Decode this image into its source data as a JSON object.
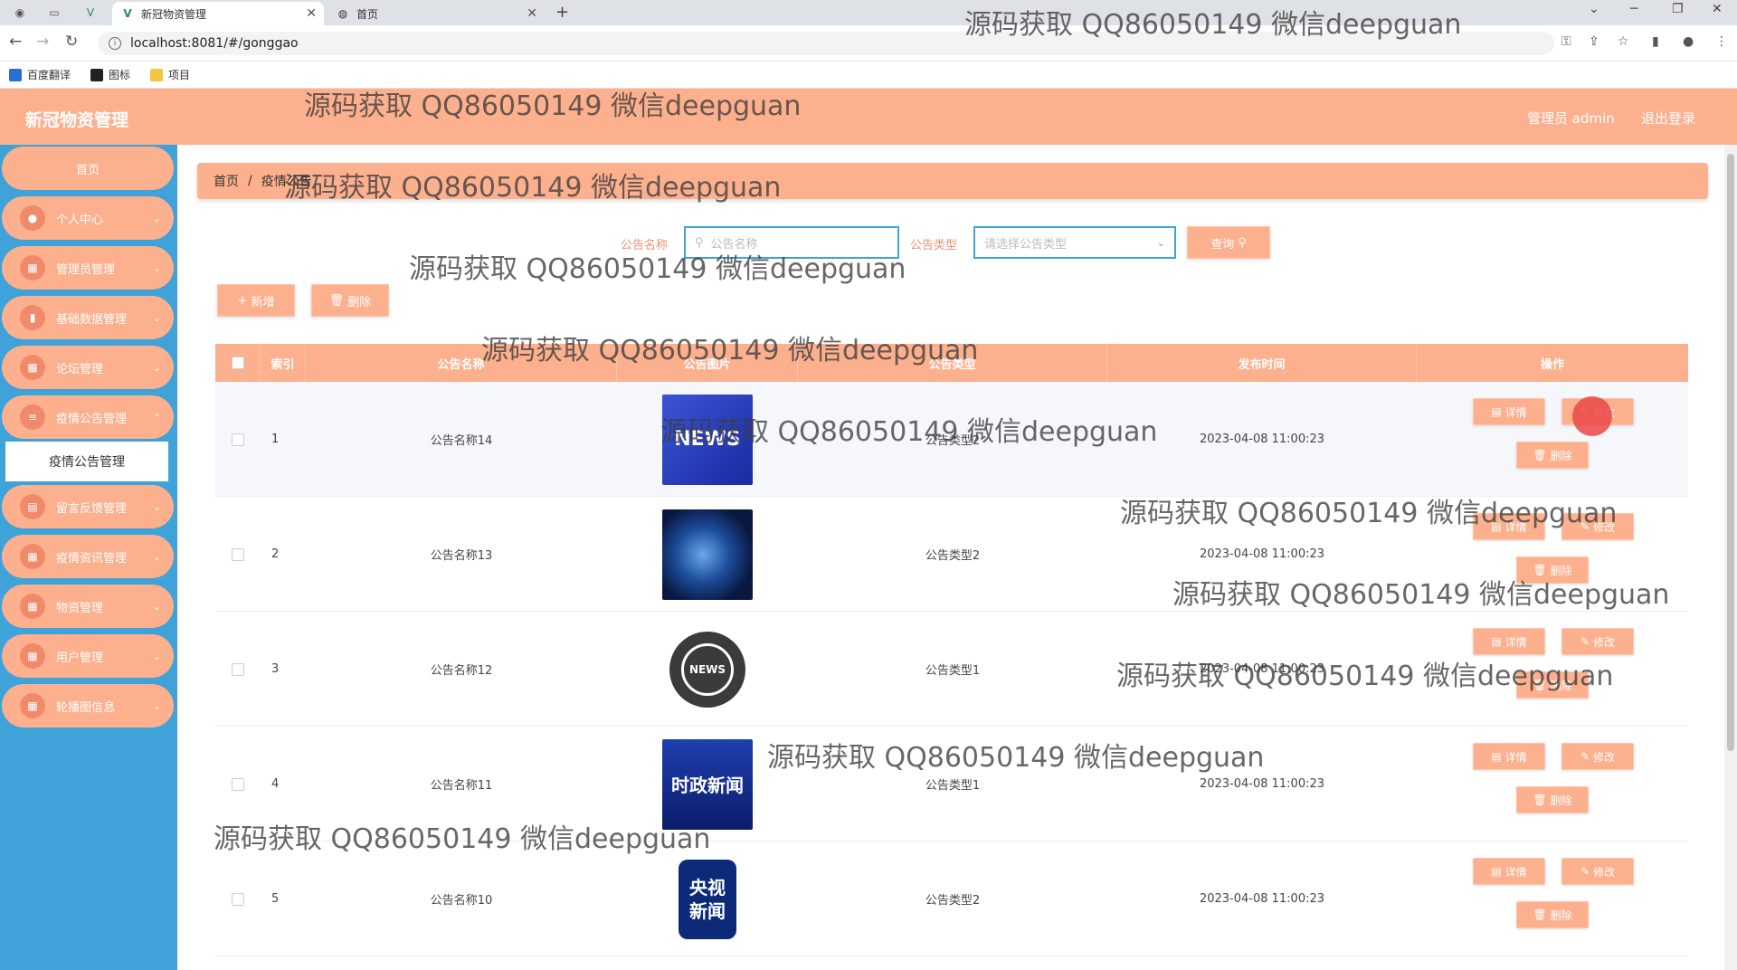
{
  "browser": {
    "tabs": [
      {
        "label": "新冠物资管理",
        "active": true
      },
      {
        "label": "首页",
        "active": false
      }
    ],
    "url": "localhost:8081/#/gonggao",
    "bookmarks": [
      "百度翻译",
      "图标",
      "项目"
    ]
  },
  "header": {
    "title": "新冠物资管理",
    "user": "管理员 admin",
    "logout": "退出登录"
  },
  "sidebar": {
    "home": "首页",
    "items": [
      {
        "label": "个人中心",
        "icon": "user-icon"
      },
      {
        "label": "管理员管理",
        "icon": "grid-icon"
      },
      {
        "label": "基础数据管理",
        "icon": "chart-icon"
      },
      {
        "label": "论坛管理",
        "icon": "grid-icon"
      },
      {
        "label": "疫情公告管理",
        "icon": "list-icon"
      },
      {
        "label": "留言反馈管理",
        "icon": "doc-icon"
      },
      {
        "label": "疫情资讯管理",
        "icon": "grid-icon"
      },
      {
        "label": "物资管理",
        "icon": "grid-icon"
      },
      {
        "label": "用户管理",
        "icon": "grid-icon"
      },
      {
        "label": "轮播图信息",
        "icon": "grid-icon"
      }
    ],
    "submenu": "疫情公告管理"
  },
  "breadcrumb": {
    "home": "首页",
    "current": "疫情公告"
  },
  "search": {
    "name_label": "公告名称",
    "name_placeholder": "公告名称",
    "type_label": "公告类型",
    "type_placeholder": "请选择公告类型",
    "query_button": "查询"
  },
  "toolbar": {
    "add": "新增",
    "delete": "删除"
  },
  "table": {
    "headers": [
      "索引",
      "公告名称",
      "公告图片",
      "公告类型",
      "发布时间",
      "操作"
    ],
    "rows": [
      {
        "index": "1",
        "name": "公告名称14",
        "type": "公告类型2",
        "time": "2023-04-08 11:00:23",
        "img_text": "NEWS"
      },
      {
        "index": "2",
        "name": "公告名称13",
        "type": "公告类型2",
        "time": "2023-04-08 11:00:23",
        "img_text": ""
      },
      {
        "index": "3",
        "name": "公告名称12",
        "type": "公告类型1",
        "time": "2023-04-08 11:00:23",
        "img_text": "NEWS"
      },
      {
        "index": "4",
        "name": "公告名称11",
        "type": "公告类型1",
        "time": "2023-04-08 11:00:23",
        "img_text": "时政新闻"
      },
      {
        "index": "5",
        "name": "公告名称10",
        "type": "公告类型2",
        "time": "2023-04-08 11:00:23",
        "img_text": "央视新闻"
      }
    ],
    "actions": {
      "detail": "详情",
      "edit": "修改",
      "delete": "删除"
    }
  },
  "watermark": "源码获取 QQ86050149 微信deepguan"
}
